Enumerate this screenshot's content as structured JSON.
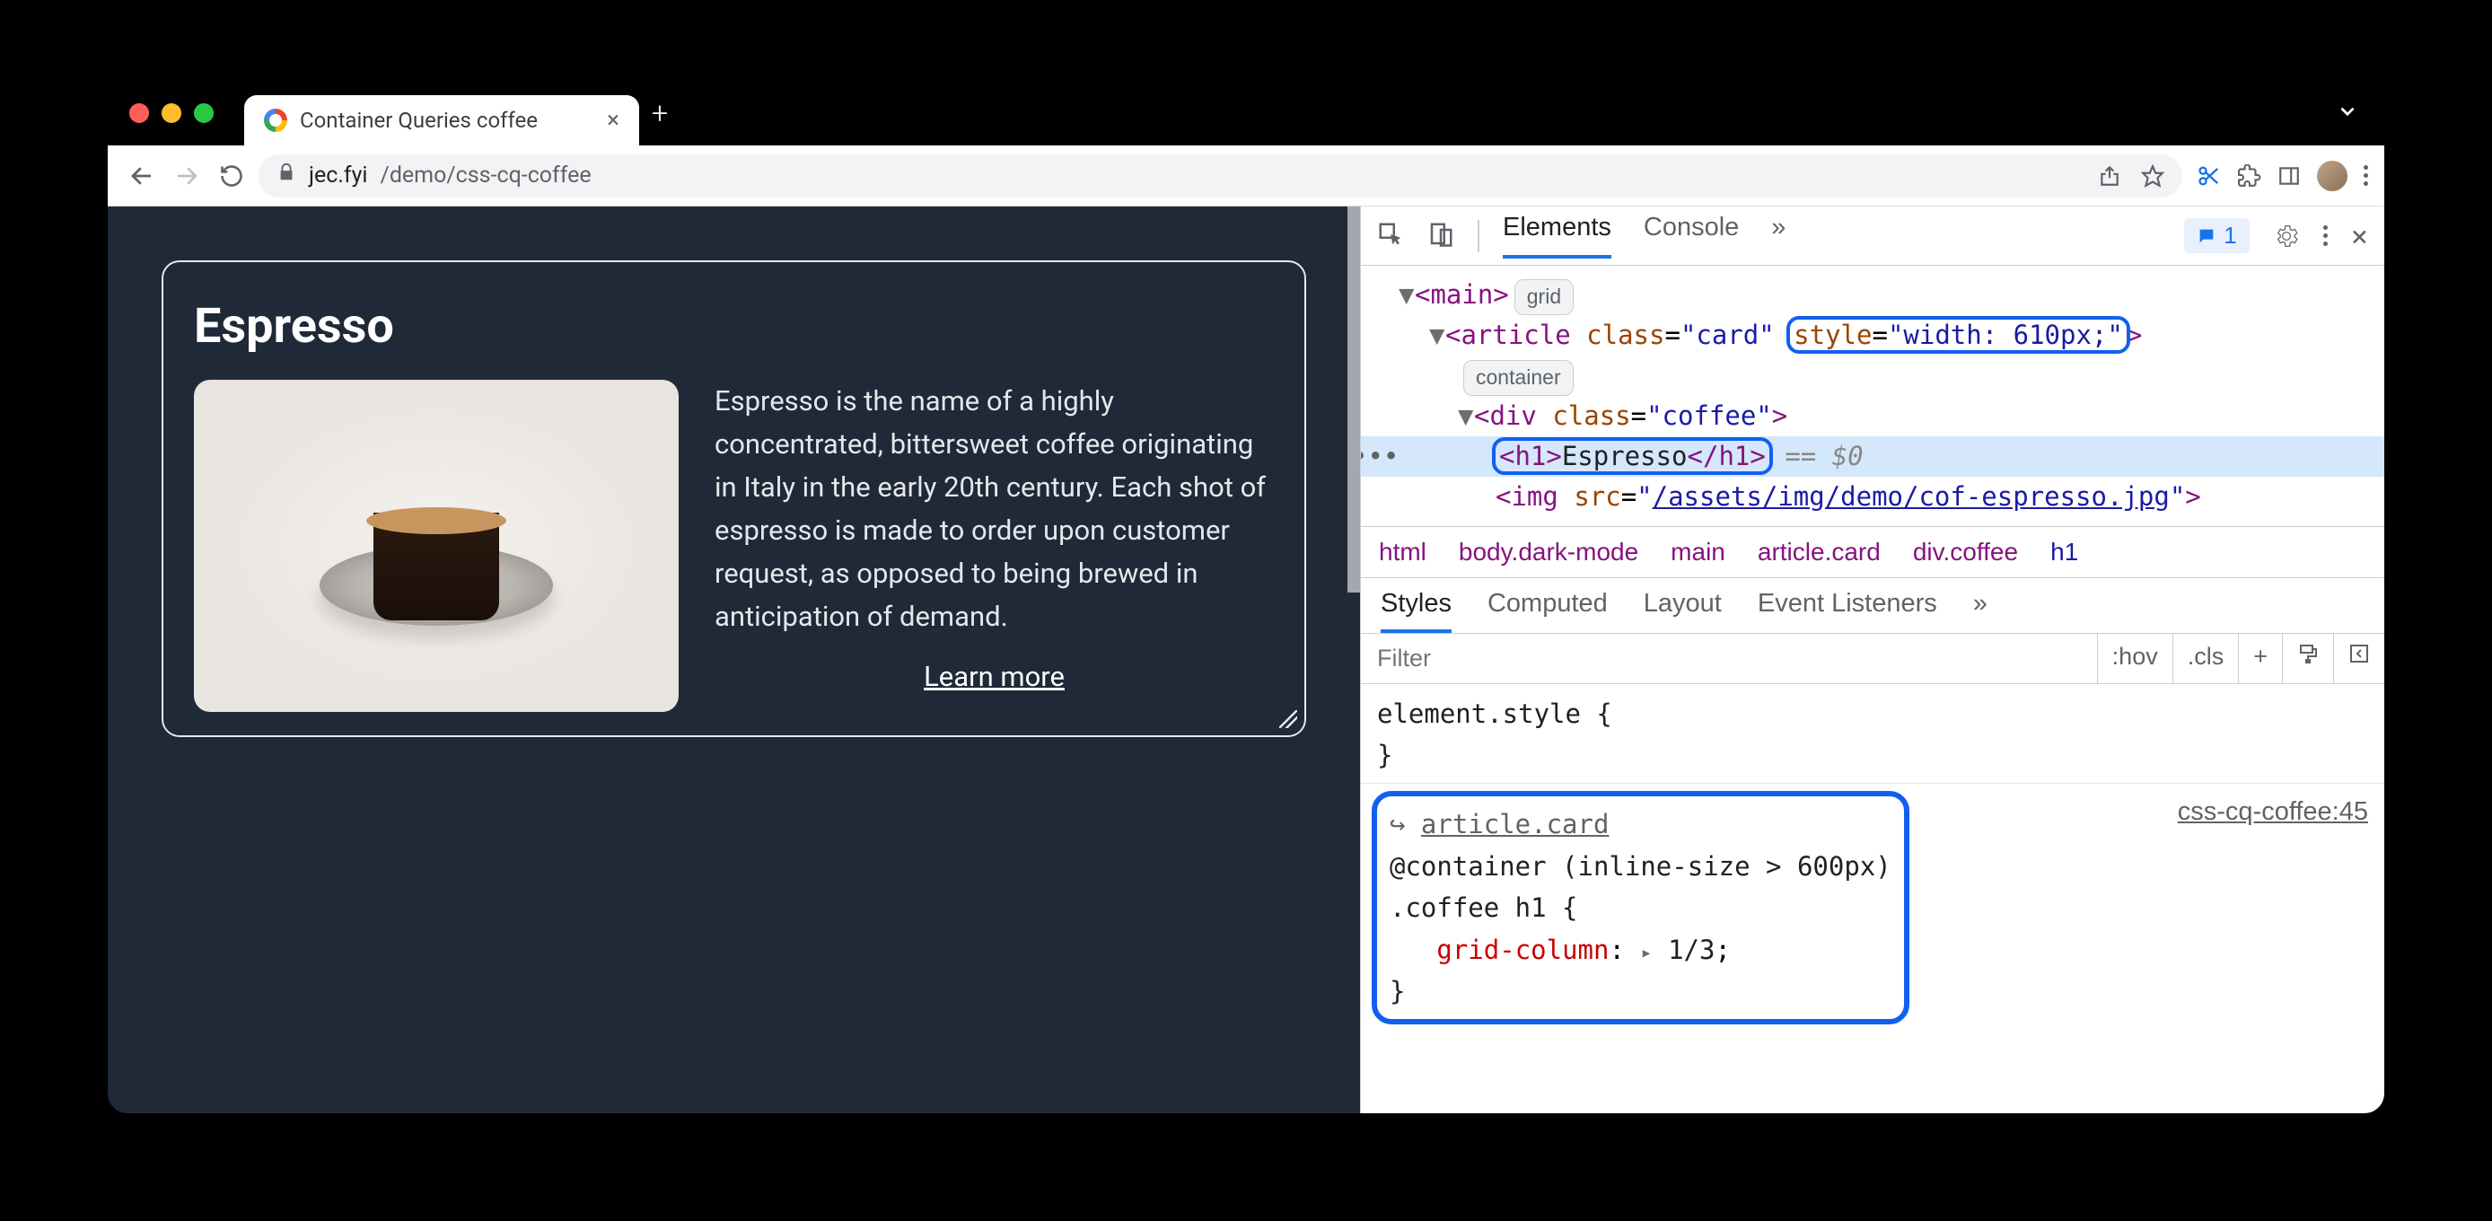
{
  "browser": {
    "tab_title": "Container Queries coffee",
    "url_host": "jec.fyi",
    "url_path": "/demo/css-cq-coffee"
  },
  "page": {
    "heading": "Espresso",
    "description": "Espresso is the name of a highly concentrated, bittersweet coffee originating in Italy in the early 20th century. Each shot of espresso is made to order upon customer request, as opposed to being brewed in anticipation of demand.",
    "learn_more": "Learn more"
  },
  "devtools": {
    "tabs": {
      "elements": "Elements",
      "console": "Console"
    },
    "issue_count": "1",
    "dom": {
      "main_tag": "main",
      "main_badge": "grid",
      "article_open": "<article class=\"card\" ",
      "article_style_attr": "style=\"width: 610px;\"",
      "article_close": ">",
      "article_badge": "container",
      "div_open": "<div class=\"coffee\">",
      "h1": "<h1>Espresso</h1>",
      "h1_tail": "== $0",
      "img_open": "<img src=\"",
      "img_src": "/assets/img/demo/cof-espresso.jpg",
      "img_close": "\">"
    },
    "crumbs": [
      "html",
      "body.dark-mode",
      "main",
      "article.card",
      "div.coffee",
      "h1"
    ],
    "style_tabs": {
      "styles": "Styles",
      "computed": "Computed",
      "layout": "Layout",
      "event": "Event Listeners"
    },
    "filter_placeholder": "Filter",
    "filter_hov": ":hov",
    "filter_cls": ".cls",
    "rules": {
      "element_style": "element.style {",
      "element_style_close": "}",
      "query_link": "article.card",
      "container_line": "@container (inline-size > 600px)",
      "selector": ".coffee h1 {",
      "prop": "grid-column",
      "val": "1/3",
      "close": "}",
      "source": "css-cq-coffee:45"
    }
  }
}
